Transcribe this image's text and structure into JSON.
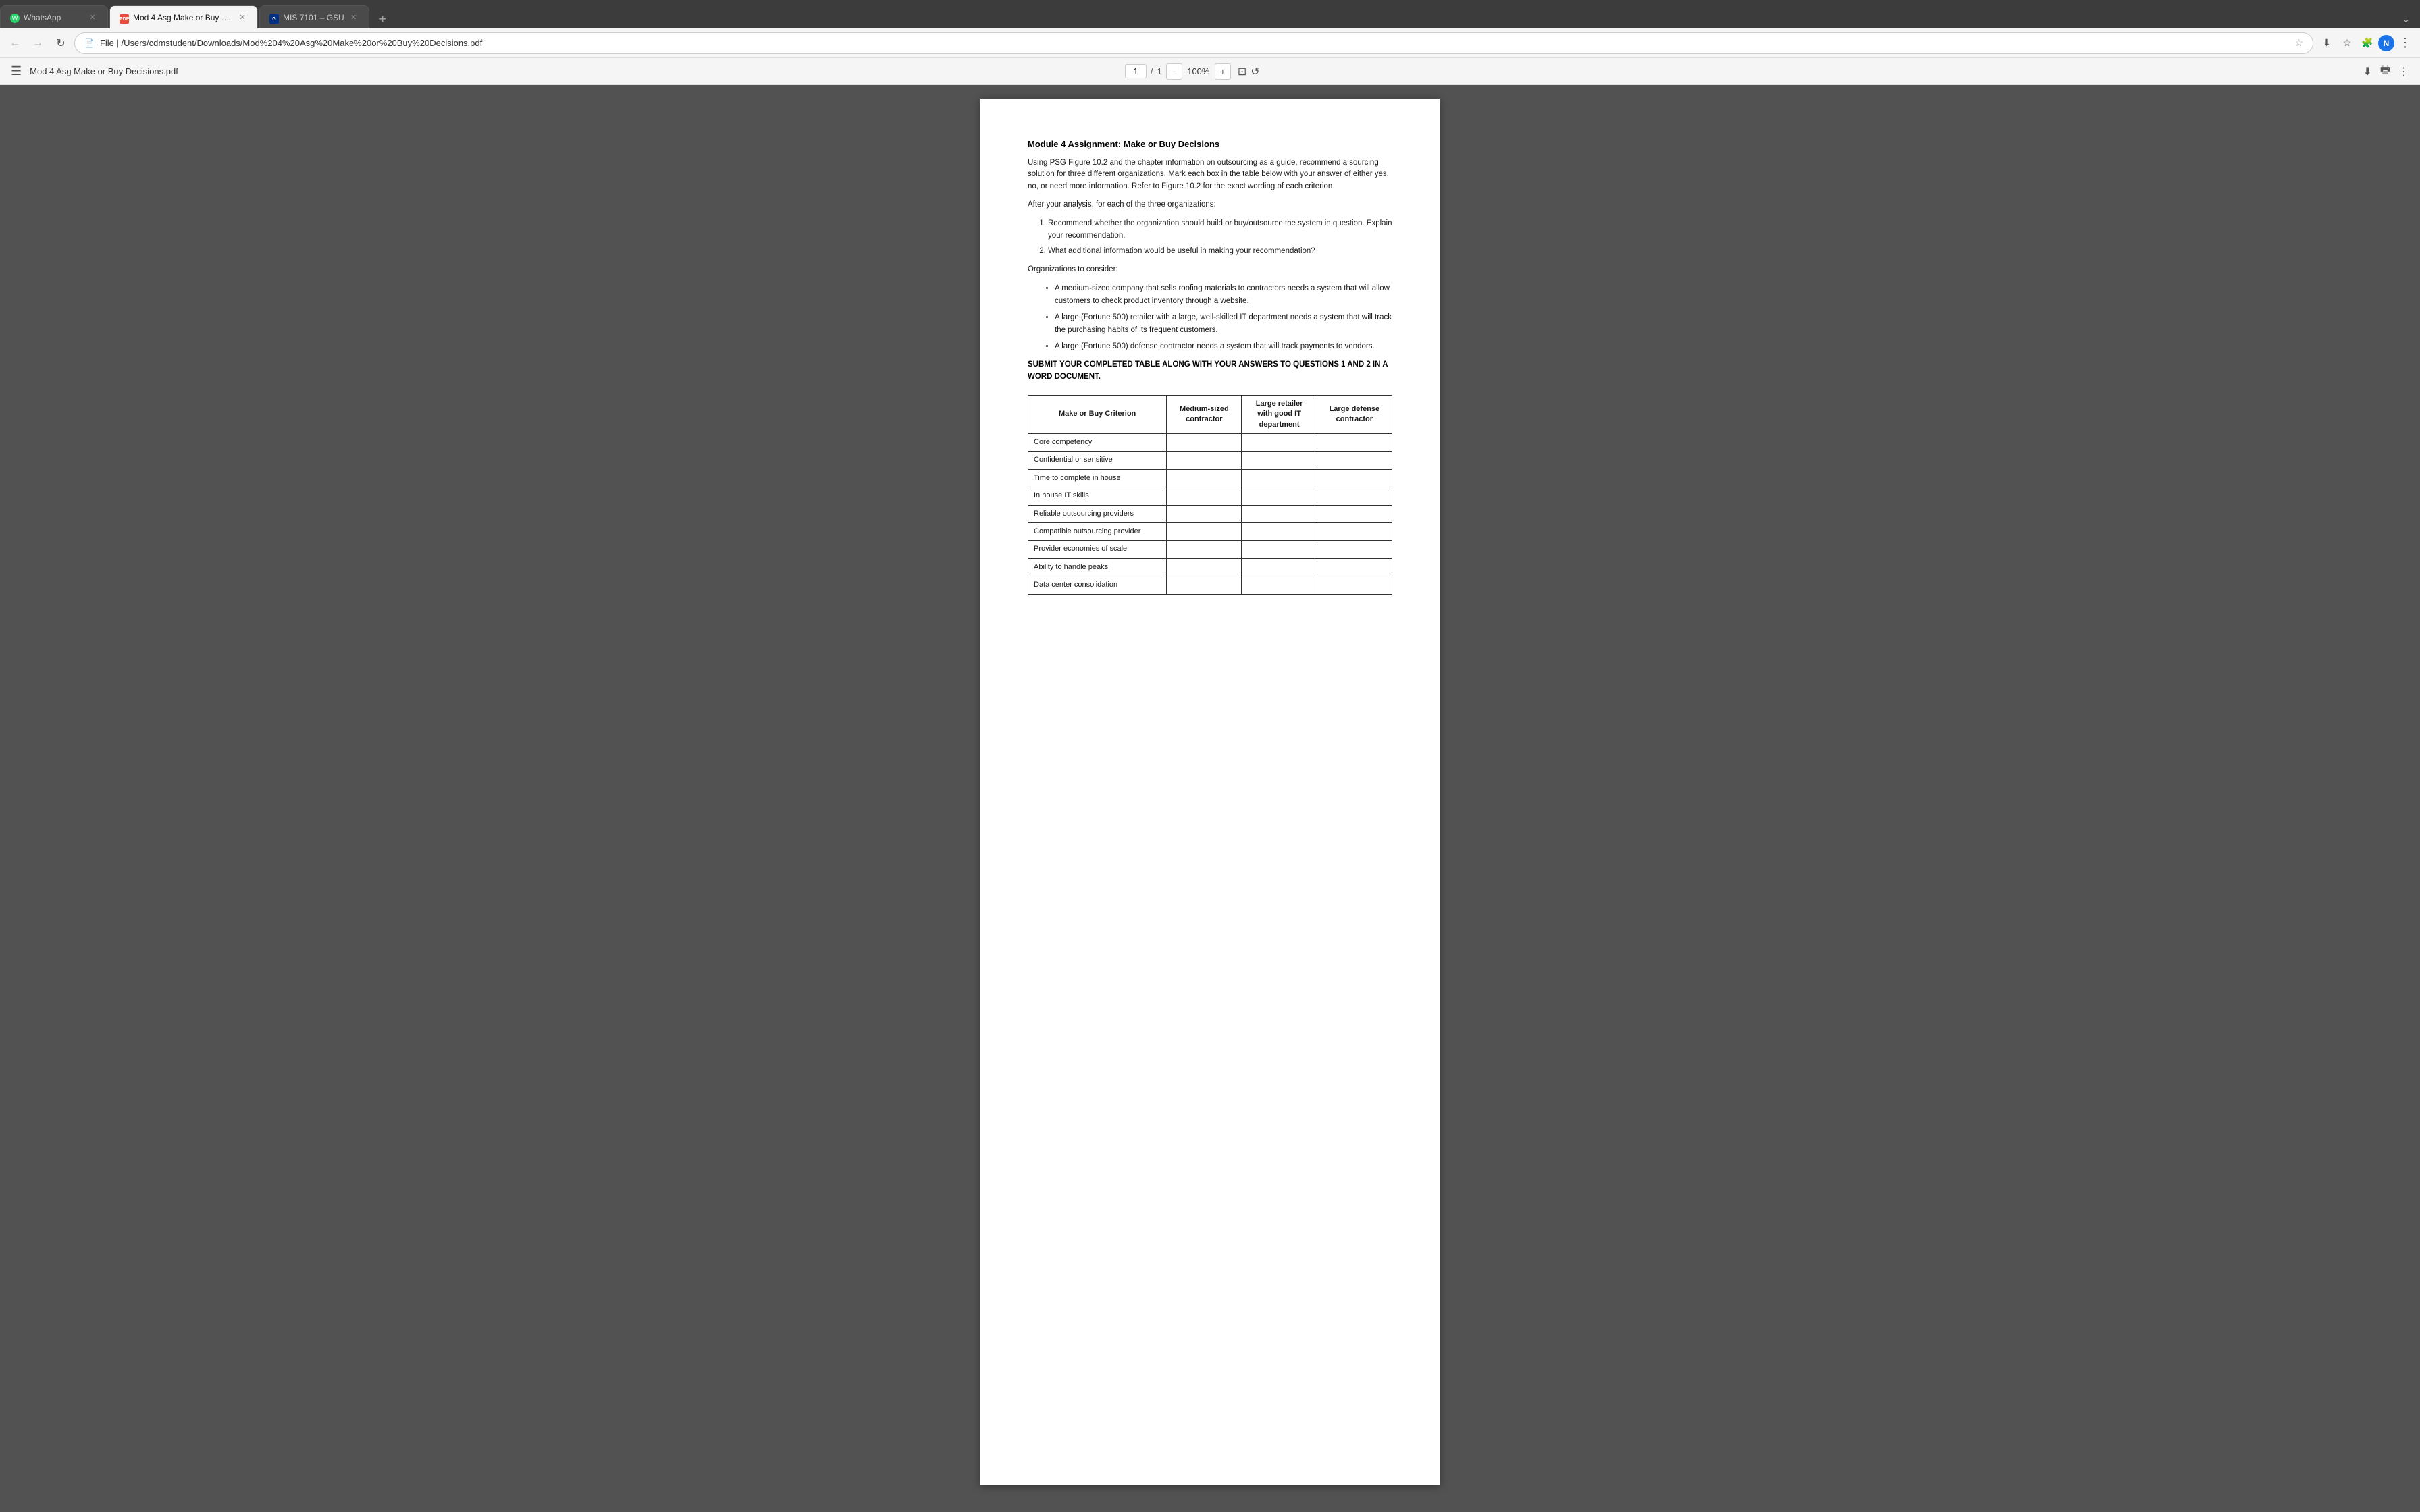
{
  "browser": {
    "tabs": [
      {
        "id": "whatsapp",
        "label": "WhatsApp",
        "favicon_type": "whatsapp",
        "active": false
      },
      {
        "id": "pdf",
        "label": "Mod 4 Asg Make or Buy Deci...",
        "favicon_type": "pdf",
        "active": true
      },
      {
        "id": "gsu",
        "label": "MIS 7101 – GSU",
        "favicon_type": "gsu",
        "active": false
      }
    ],
    "address": "File | /Users/cdmstudent/Downloads/Mod%204%20Asg%20Make%20or%20Buy%20Decisions.pdf",
    "new_tab_label": "+"
  },
  "pdf_toolbar": {
    "menu_icon": "☰",
    "title": "Mod 4 Asg Make or Buy Decisions.pdf",
    "page_current": "1",
    "page_separator": "/",
    "page_total": "1",
    "zoom_out_label": "−",
    "zoom_value": "100%",
    "zoom_in_label": "+",
    "fit_icon": "⊡",
    "rotate_icon": "↺",
    "download_icon": "⬇",
    "print_icon": "🖶",
    "more_icon": "⋮"
  },
  "document": {
    "title": "Module 4 Assignment: Make or Buy Decisions",
    "intro_paragraph": "Using PSG Figure 10.2 and the chapter information on outsourcing as a guide, recommend a sourcing solution for three different organizations. Mark each box in the table below with your answer of either yes, no, or need more information. Refer to Figure 10.2 for the exact wording of each criterion.",
    "after_analysis_heading": "After your analysis, for each of the three organizations:",
    "numbered_items": [
      "Recommend whether the organization should build or buy/outsource the system in question. Explain your recommendation.",
      "What additional information would be useful in making your recommendation?"
    ],
    "orgs_heading": "Organizations to consider:",
    "org_bullets": [
      "A medium-sized company that sells roofing materials to contractors needs a system that will allow customers to check product inventory through a website.",
      "A large (Fortune 500) retailer with a large, well-skilled IT department needs a system that will track the purchasing habits of its frequent customers.",
      "A large (Fortune 500) defense contractor needs a system that will track payments to vendors."
    ],
    "submit_bold": "SUBMIT YOUR COMPLETED TABLE ALONG WITH YOUR ANSWERS TO QUESTIONS 1 AND 2 IN A WORD DOCUMENT.",
    "table": {
      "headers": [
        "Make or Buy Criterion",
        "Medium-sized contractor",
        "Large retailer with good IT department",
        "Large defense contractor"
      ],
      "rows": [
        [
          "Core competency",
          "",
          "",
          ""
        ],
        [
          "Confidential or sensitive",
          "",
          "",
          ""
        ],
        [
          "Time to complete in house",
          "",
          "",
          ""
        ],
        [
          "In house IT skills",
          "",
          "",
          ""
        ],
        [
          "Reliable outsourcing providers",
          "",
          "",
          ""
        ],
        [
          "Compatible outsourcing provider",
          "",
          "",
          ""
        ],
        [
          "Provider economies of scale",
          "",
          "",
          ""
        ],
        [
          "Ability to handle peaks",
          "",
          "",
          ""
        ],
        [
          "Data center consolidation",
          "",
          "",
          ""
        ]
      ]
    }
  }
}
